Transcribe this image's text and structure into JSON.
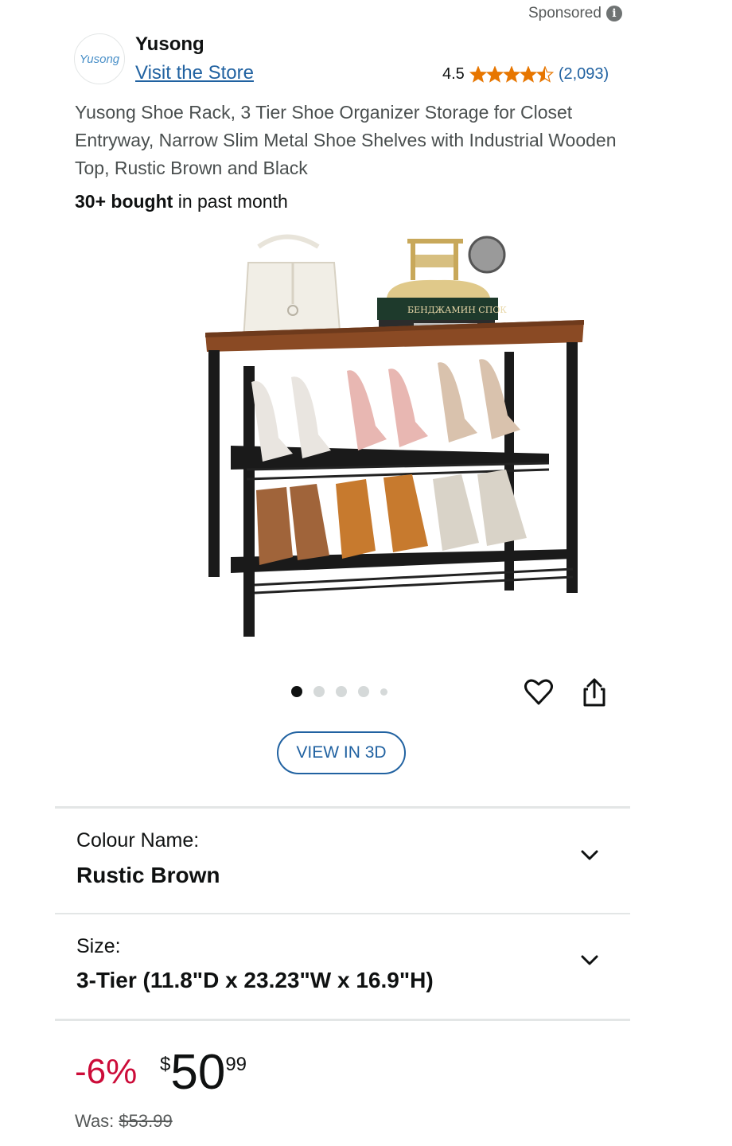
{
  "sponsored": "Sponsored",
  "brand": {
    "logo_text": "Yusong",
    "name": "Yusong",
    "visit_store": "Visit the Store"
  },
  "rating": {
    "value": "4.5",
    "stars": 4.5,
    "count": "(2,093)"
  },
  "product": {
    "title": "Yusong Shoe Rack, 3 Tier Shoe Organizer Storage for Closet Entryway, Narrow Slim Metal Shoe Shelves with Industrial Wooden Top, Rustic Brown and Black",
    "bought_bold": "30+ bought",
    "bought_rest": " in past month",
    "book_text": "БЕНДЖАМИН СПОК"
  },
  "gallery": {
    "total_images": 5,
    "active_index": 0
  },
  "view_3d": "VIEW IN 3D",
  "options": {
    "colour_label": "Colour Name:",
    "colour_value": "Rustic Brown",
    "size_label": "Size:",
    "size_value": "3-Tier (11.8\"D x 23.23\"W x 16.9\"H)"
  },
  "price": {
    "discount": "-6%",
    "symbol": "$",
    "whole": "50",
    "fraction": "99",
    "was_label": "Was: ",
    "was_price": "$53.99"
  },
  "colors": {
    "link": "#2162a1",
    "star": "#e77600",
    "discount": "#cc0c39"
  }
}
